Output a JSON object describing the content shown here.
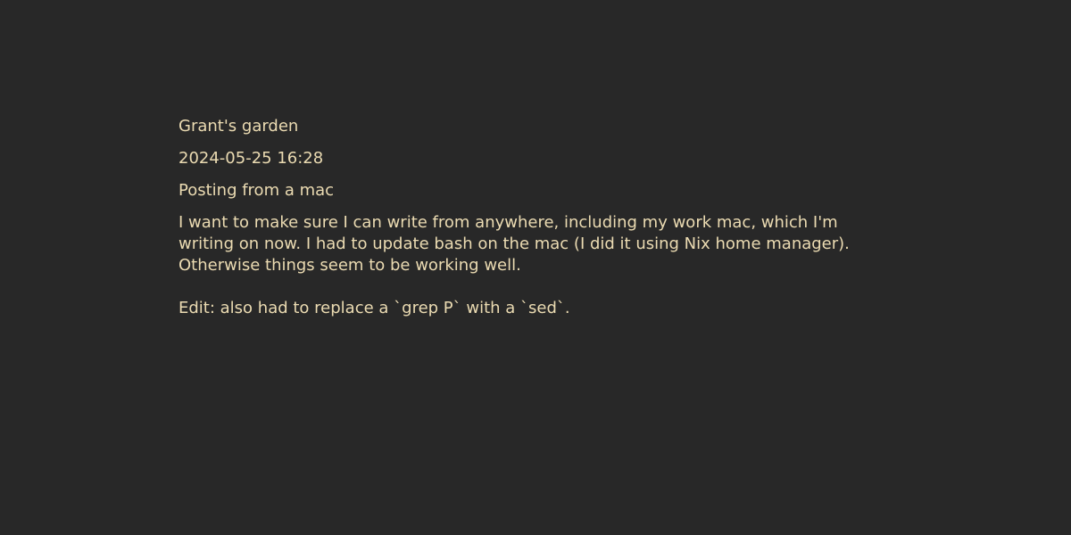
{
  "site": {
    "title": "Grant's garden"
  },
  "post": {
    "date": "2024-05-25 16:28",
    "title": "Posting from a mac",
    "body_lines": [
      "I want to make sure I can write from anywhere, including my work mac, which I'm",
      "writing on now. I had to update bash on the mac (I did it using Nix home manager).",
      "Otherwise things seem to be working well."
    ],
    "edit_note": "Edit: also had to replace a `grep P` with a `sed`."
  },
  "colors": {
    "background": "#282828",
    "text": "#ebdbb2"
  }
}
